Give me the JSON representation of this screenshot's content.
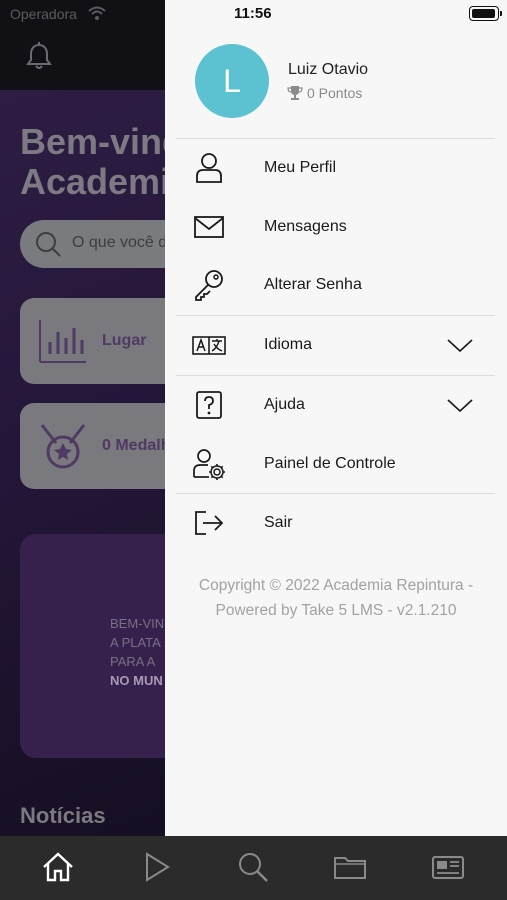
{
  "status_bar": {
    "carrier": "Operadora",
    "time": "11:56"
  },
  "background": {
    "welcome_title": "Bem-vindo\nAcademia",
    "search_placeholder": "O que você d",
    "card_place_label": "Lugar",
    "card_medals_label": "0 Medalh",
    "banner_text_lines": [
      "BEM-VIN",
      "A PLATA",
      "PARA A",
      "NO MUN"
    ],
    "news_heading": "Notícias"
  },
  "user": {
    "initial": "L",
    "name": "Luiz Otavio",
    "points": "0 Pontos"
  },
  "menu": [
    {
      "label": "Meu Perfil",
      "icon": "user-icon"
    },
    {
      "label": "Mensagens",
      "icon": "envelope-icon"
    },
    {
      "label": "Alterar Senha",
      "icon": "key-icon"
    },
    {
      "label": "Idioma",
      "icon": "translate-icon",
      "expandable": true
    },
    {
      "label": "Ajuda",
      "icon": "help-icon",
      "expandable": true
    },
    {
      "label": "Painel de Controle",
      "icon": "user-settings-icon"
    },
    {
      "label": "Sair",
      "icon": "logout-icon"
    }
  ],
  "copyright": "Copyright © 2022 Academia Repintura -\nPowered by Take 5 LMS - v2.1.210",
  "tabbar": [
    {
      "icon": "home-icon",
      "active": true
    },
    {
      "icon": "play-icon",
      "active": false
    },
    {
      "icon": "search-icon",
      "active": false
    },
    {
      "icon": "folder-icon",
      "active": false
    },
    {
      "icon": "news-icon",
      "active": false
    }
  ],
  "colors": {
    "avatar": "#5cc1d0",
    "drawer_bg": "#f7f7f7",
    "tabbar_bg": "#2b2b2b",
    "active_tab": "#ffffff",
    "inactive_tab": "#8a8a8a"
  }
}
